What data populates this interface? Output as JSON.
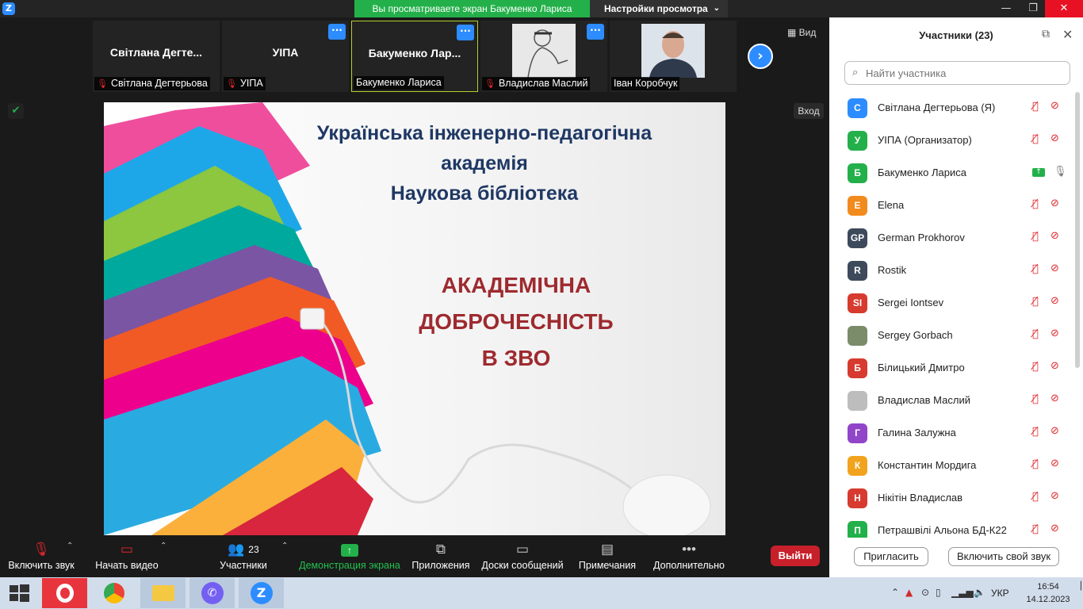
{
  "titlebar": {
    "logo_letter": "Z",
    "share_banner": "Вы просматриваете экран Бакуменко Лариса",
    "view_settings": "Настройки просмотра",
    "colors": {
      "banner": "#23b04a",
      "accent": "#2d8cff"
    }
  },
  "thumbnails": [
    {
      "big": "Світлана  Дегте...",
      "label": "Світлана Дегтерьова",
      "muted": true
    },
    {
      "big": "УІПА",
      "label": "УІПА",
      "muted": true
    },
    {
      "big": "Бакуменко  Лар...",
      "label": "Бакуменко Лариса",
      "muted": false
    },
    {
      "big": "",
      "label": "Владислав Маслий",
      "muted": true
    },
    {
      "big": "",
      "label": "Іван Коробчук",
      "muted": false
    }
  ],
  "strip": {
    "view_label": "Вид",
    "enter_label": "Вход"
  },
  "slide": {
    "title_lines": [
      "Українська інженерно-педагогічна",
      "академія",
      "Наукова бібліотека"
    ],
    "heading_lines": [
      "АКАДЕМІЧНА",
      "ДОБРОЧЕСНІСТЬ",
      "В ЗВО"
    ]
  },
  "toolbar": {
    "audio": "Включить звук",
    "video": "Начать видео",
    "participants": "Участники",
    "participants_count": "23",
    "share": "Демонстрация экрана",
    "apps": "Приложения",
    "whiteboards": "Доски сообщений",
    "notes": "Примечания",
    "more": "Дополнительно",
    "leave": "Выйти"
  },
  "panel": {
    "title": "Участники (23)",
    "search_placeholder": "Найти участника",
    "invite": "Пригласить",
    "unmute_self": "Включить свой звук",
    "participants": [
      {
        "initials": "С",
        "name": "Світлана Дегтерьова (Я)",
        "color": "#2d8cff",
        "state": "off"
      },
      {
        "initials": "У",
        "name": "УІПА (Организатор)",
        "color": "#23b04a",
        "state": "off"
      },
      {
        "initials": "Б",
        "name": "Бакуменко Лариса",
        "color": "#23b04a",
        "state": "sharing"
      },
      {
        "initials": "E",
        "name": "Elena",
        "color": "#f28b1d",
        "state": "off"
      },
      {
        "initials": "GP",
        "name": "German Prokhorov",
        "color": "#3d4a5c",
        "state": "off"
      },
      {
        "initials": "R",
        "name": "Rostik",
        "color": "#3d4a5c",
        "state": "off"
      },
      {
        "initials": "SI",
        "name": "Sergei Iontsev",
        "color": "#d73a2e",
        "state": "off"
      },
      {
        "initials": "",
        "name": "Sergey Gorbach",
        "color": "#7a8c6a",
        "state": "off"
      },
      {
        "initials": "Б",
        "name": "Білицький Дмитро",
        "color": "#d73a2e",
        "state": "off"
      },
      {
        "initials": "",
        "name": "Владислав Маслий",
        "color": "#bdbdbd",
        "state": "off"
      },
      {
        "initials": "Г",
        "name": "Галина Залужна",
        "color": "#9146c9",
        "state": "off"
      },
      {
        "initials": "К",
        "name": "Константин  Мордига",
        "color": "#f2a31d",
        "state": "off"
      },
      {
        "initials": "Н",
        "name": "Нікітін Владислав",
        "color": "#d73a2e",
        "state": "off"
      },
      {
        "initials": "П",
        "name": "Петрашвілі Альона БД-К22",
        "color": "#23b04a",
        "state": "off"
      }
    ]
  },
  "taskbar": {
    "lang": "УКР",
    "time": "16:54",
    "date": "14.12.2023",
    "zoom_letter": "Z"
  }
}
